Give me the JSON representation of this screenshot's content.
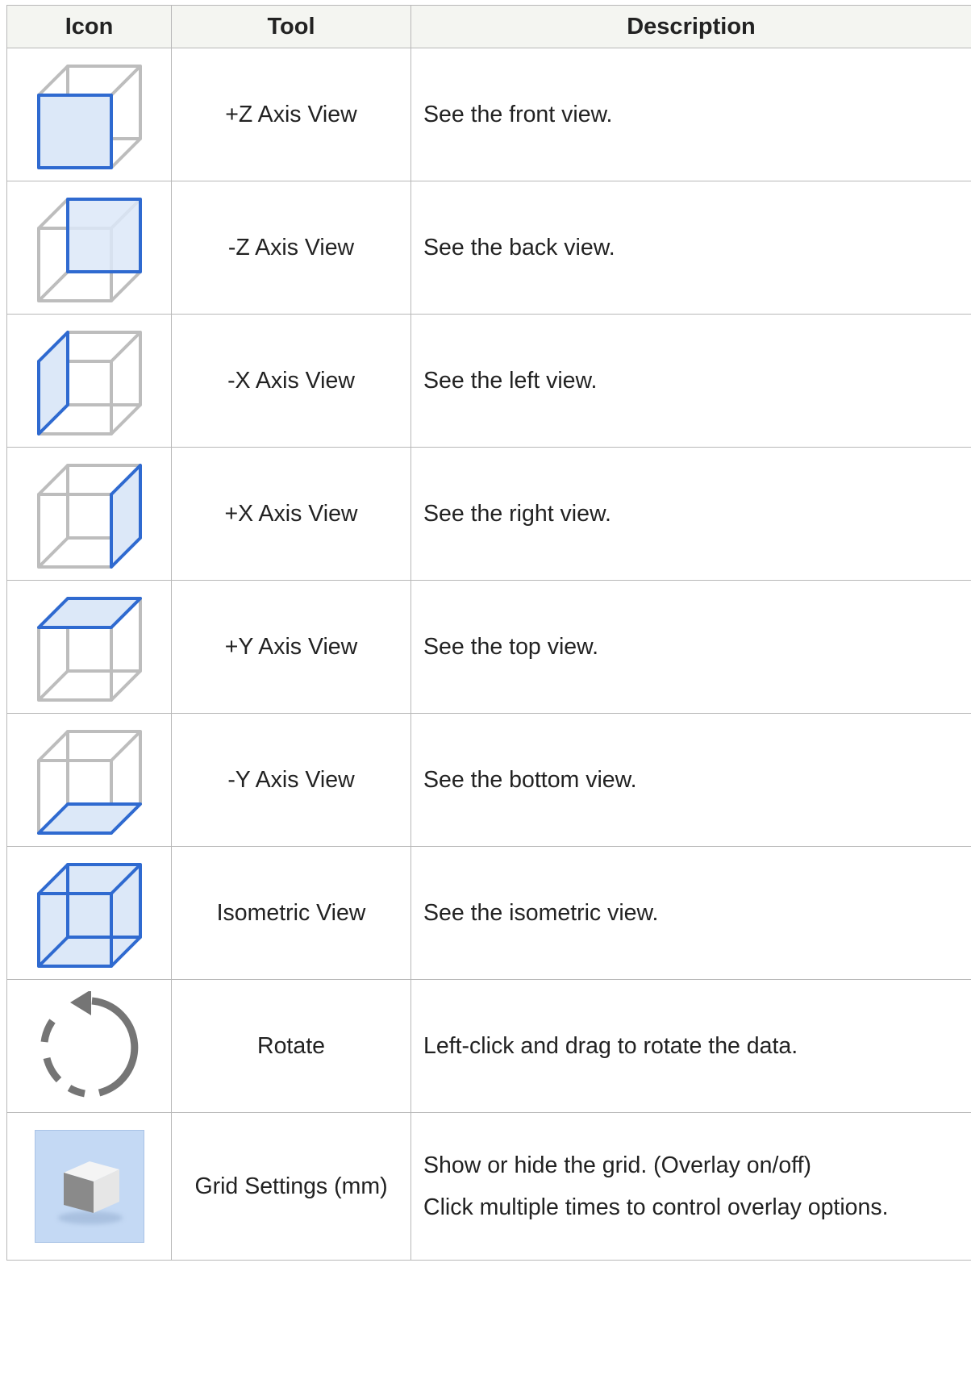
{
  "headers": {
    "icon": "Icon",
    "tool": "Tool",
    "description": "Description"
  },
  "colors": {
    "highlight_edge": "#2f6ad0",
    "highlight_fill": "#dce8f8",
    "frame_gray": "#bdbdbd",
    "rotate_gray": "#757575",
    "grid_bg": "#c4d9f4"
  },
  "rows": [
    {
      "icon": "cube-front-face-icon",
      "tool": "+Z Axis View",
      "description": [
        "See the front view."
      ]
    },
    {
      "icon": "cube-back-face-icon",
      "tool": "-Z Axis View",
      "description": [
        "See the back view."
      ]
    },
    {
      "icon": "cube-left-face-icon",
      "tool": "-X Axis View",
      "description": [
        "See the left view."
      ]
    },
    {
      "icon": "cube-right-face-icon",
      "tool": "+X Axis View",
      "description": [
        "See the right view."
      ]
    },
    {
      "icon": "cube-top-face-icon",
      "tool": "+Y Axis View",
      "description": [
        "See the top view."
      ]
    },
    {
      "icon": "cube-bottom-face-icon",
      "tool": "-Y Axis View",
      "description": [
        "See the bottom view."
      ]
    },
    {
      "icon": "cube-isometric-icon",
      "tool": "Isometric View",
      "description": [
        "See the isometric view."
      ]
    },
    {
      "icon": "rotate-icon",
      "tool": "Rotate",
      "description": [
        "Left-click and drag to rotate the data."
      ]
    },
    {
      "icon": "grid-settings-icon",
      "tool": "Grid Settings (mm)",
      "description": [
        "Show or hide the grid. (Overlay on/off)",
        "Click multiple times to control overlay options."
      ]
    }
  ]
}
